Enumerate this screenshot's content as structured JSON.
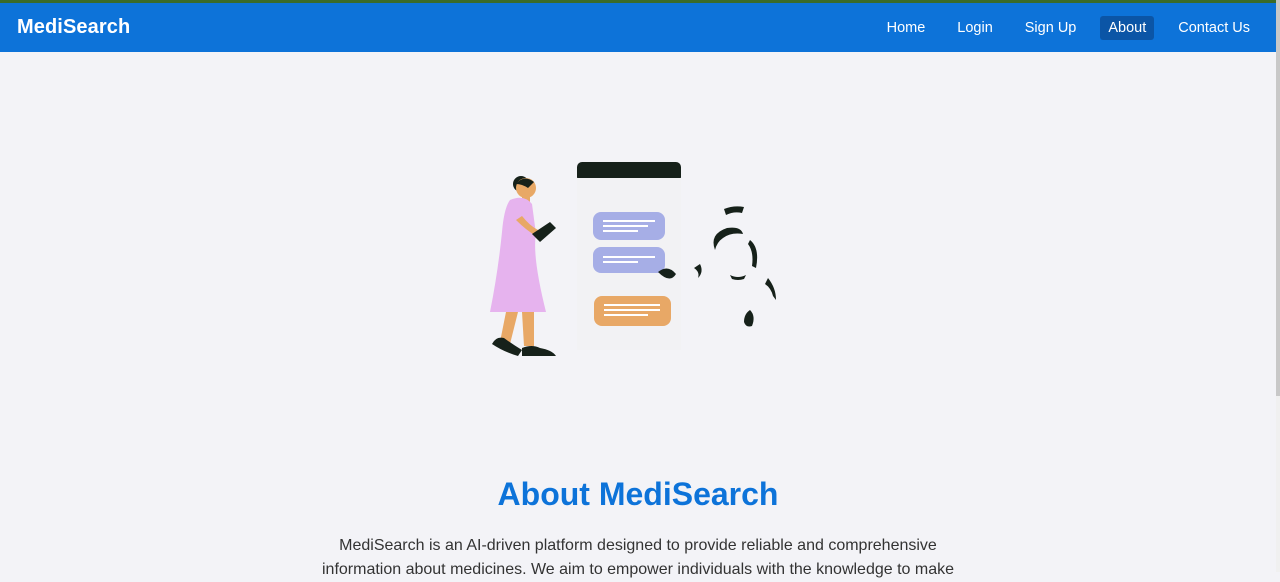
{
  "brand": "MediSearch",
  "nav": {
    "items": [
      {
        "label": "Home"
      },
      {
        "label": "Login"
      },
      {
        "label": "Sign Up"
      },
      {
        "label": "About",
        "active": true
      },
      {
        "label": "Contact Us"
      }
    ]
  },
  "about": {
    "title": "About MediSearch",
    "text": "MediSearch is an AI-driven platform designed to provide reliable and comprehensive information about medicines. We aim to empower individuals with the knowledge to make"
  },
  "colors": {
    "primary": "#0d73d9",
    "active_nav": "#0b55a6",
    "background": "#f3f3f7",
    "accent_top": "#3a6b2a"
  },
  "illustration": {
    "icon": "chat-assistant-illustration"
  }
}
